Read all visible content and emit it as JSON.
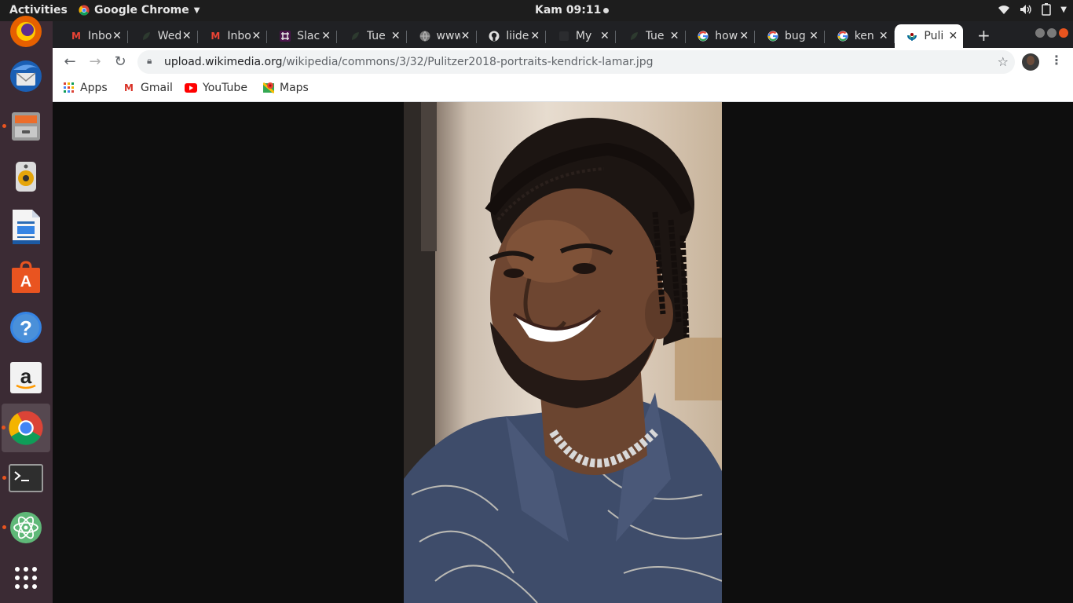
{
  "topbar": {
    "activities": "Activities",
    "app_name": "Google Chrome",
    "clock": "Kam 09:11"
  },
  "dock": {
    "items": [
      "Firefox",
      "Thunderbird",
      "Files",
      "Rhythmbox",
      "LibreOffice Writer",
      "Ubuntu Software",
      "Help",
      "Amazon",
      "Google Chrome",
      "Terminal",
      "Atom",
      "Show Applications"
    ]
  },
  "tabs": [
    {
      "title": "Inbox",
      "icon": "gmail-icon"
    },
    {
      "title": "Wed",
      "icon": "leaf-icon"
    },
    {
      "title": "Inbox",
      "icon": "gmail-icon"
    },
    {
      "title": "Slack",
      "icon": "slack-icon"
    },
    {
      "title": "Tue",
      "icon": "leaf-icon"
    },
    {
      "title": "www",
      "icon": "globe-icon"
    },
    {
      "title": "liide",
      "icon": "github-icon"
    },
    {
      "title": "My",
      "icon": "blank-icon"
    },
    {
      "title": "Tue",
      "icon": "leaf-icon"
    },
    {
      "title": "how",
      "icon": "google-icon"
    },
    {
      "title": "bug",
      "icon": "google-icon"
    },
    {
      "title": "ken",
      "icon": "google-icon"
    },
    {
      "title": "Puli",
      "icon": "wikimedia-icon",
      "active": true
    }
  ],
  "omnibox": {
    "host": "upload.wikimedia.org",
    "path": "/wikipedia/commons/3/32/Pulitzer2018-portraits-kendrick-lamar.jpg"
  },
  "bookmarks": [
    {
      "label": "Apps",
      "icon": "apps-grid-icon"
    },
    {
      "label": "Gmail",
      "icon": "gmail-icon"
    },
    {
      "label": "YouTube",
      "icon": "youtube-icon"
    },
    {
      "label": "Maps",
      "icon": "maps-icon"
    }
  ],
  "colors": {
    "dock_bg": "#3b2b34",
    "topbar_bg": "#1d1d1d",
    "tabstrip_bg": "#202124",
    "viewer_bg": "#0e0e0e",
    "shirt": "#3e4c6a"
  }
}
